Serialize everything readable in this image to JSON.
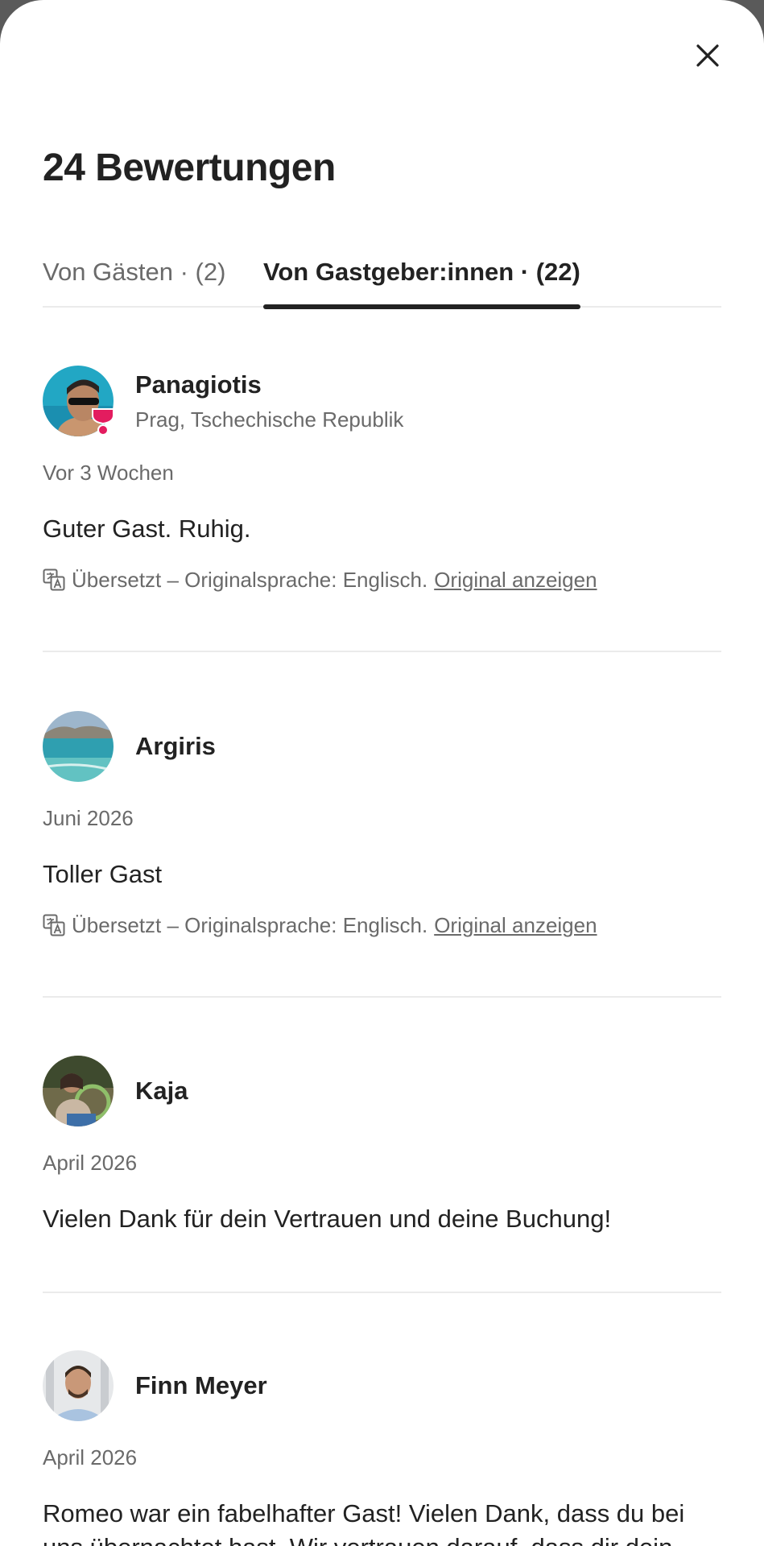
{
  "header": {
    "title": "24 Bewertungen",
    "close_icon": "close-icon"
  },
  "tabs": [
    {
      "label": "Von Gästen · (2)",
      "active": false
    },
    {
      "label": "Von Gastgeber:innen · (22)",
      "active": true
    }
  ],
  "reviews": [
    {
      "name": "Panagiotis",
      "location": "Prag, Tschechische Republik",
      "date": "Vor 3 Wochen",
      "text": "Guter Gast. Ruhig.",
      "translation_note": "Übersetzt – Originalsprache: Englisch.",
      "translation_link": "Original anzeigen",
      "has_badge": true
    },
    {
      "name": "Argiris",
      "date": "Juni 2026",
      "text": "Toller Gast",
      "translation_note": "Übersetzt – Originalsprache: Englisch.",
      "translation_link": "Original anzeigen"
    },
    {
      "name": "Kaja",
      "date": "April 2026",
      "text": "Vielen Dank für dein Vertrauen und deine Buchung!"
    },
    {
      "name": "Finn Meyer",
      "date": "April 2026",
      "text": "Romeo war ein fabelhafter Gast! Vielen Dank, dass du bei uns übernachtet hast. Wir vertrauen darauf, dass dir dein"
    }
  ],
  "colors": {
    "text_primary": "#222222",
    "text_secondary": "#6a6a6a",
    "divider": "#ebebeb",
    "badge": "#e31c5f"
  }
}
